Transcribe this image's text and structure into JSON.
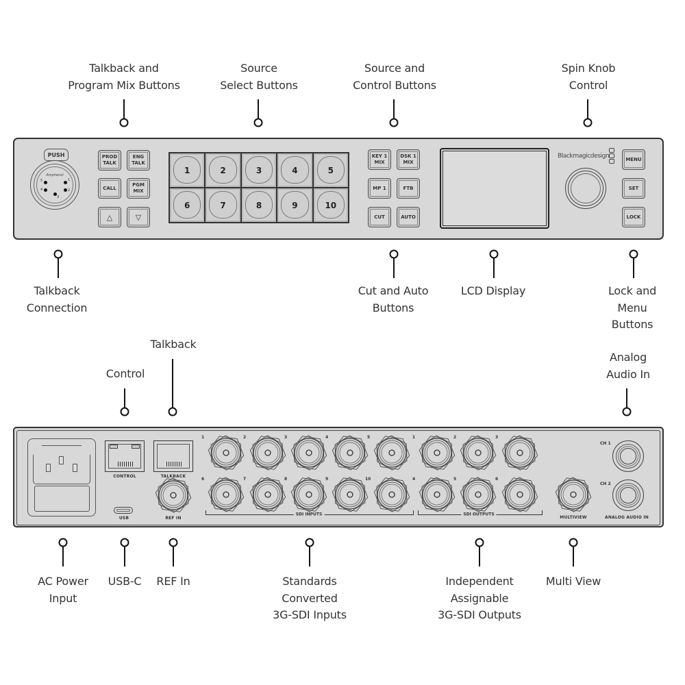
{
  "front_panel": {
    "callouts_top": [
      {
        "id": "talkback-program-mix",
        "text": "Talkback and\nProgram Mix Buttons"
      },
      {
        "id": "source-select",
        "text": "Source\nSelect Buttons"
      },
      {
        "id": "source-control",
        "text": "Source and\nControl  Buttons"
      },
      {
        "id": "spin-knob",
        "text": "Spin Knob\nControl"
      }
    ],
    "callouts_bottom": [
      {
        "id": "talkback-connection",
        "text": "Talkback\nConnection"
      },
      {
        "id": "cut-auto",
        "text": "Cut and Auto\nButtons"
      },
      {
        "id": "lcd-display",
        "text": "LCD Display"
      },
      {
        "id": "lock-menu",
        "text": "Lock and\nMenu Buttons"
      }
    ],
    "xlr": {
      "tab_label": "PUSH",
      "brand": "Amphenol",
      "pins": [
        "1",
        "2",
        "3",
        "4",
        "5"
      ]
    },
    "talkback_buttons": [
      {
        "label": "PROD\nTALK"
      },
      {
        "label": "ENG\nTALK"
      },
      {
        "label": "CALL"
      },
      {
        "label": "PGM\nMIX"
      },
      {
        "label": "△",
        "icon": "triangle-up-icon"
      },
      {
        "label": "▽",
        "icon": "triangle-down-icon"
      }
    ],
    "source_buttons": [
      "1",
      "2",
      "3",
      "4",
      "5",
      "6",
      "7",
      "8",
      "9",
      "10"
    ],
    "control_buttons": [
      {
        "label": "KEY 1\nMIX"
      },
      {
        "label": "DSK 1\nMIX"
      },
      {
        "label": "MP 1"
      },
      {
        "label": "FTB"
      },
      {
        "label": "CUT"
      },
      {
        "label": "AUTO"
      }
    ],
    "brand": "Blackmagicdesign",
    "menu_buttons": [
      {
        "label": "MENU"
      },
      {
        "label": "SET"
      },
      {
        "label": "LOCK"
      }
    ]
  },
  "rear_panel": {
    "callouts_top": [
      {
        "id": "control",
        "text": "Control"
      },
      {
        "id": "talkback",
        "text": "Talkback"
      },
      {
        "id": "analog-audio-in",
        "text": "Analog\nAudio In"
      }
    ],
    "callouts_bottom": [
      {
        "id": "ac-power",
        "text": "AC Power\nInput"
      },
      {
        "id": "usb-c",
        "text": "USB-C"
      },
      {
        "id": "ref-in",
        "text": "REF In"
      },
      {
        "id": "sdi-inputs",
        "text": "Standards\nConverted\n3G-SDI Inputs"
      },
      {
        "id": "sdi-outputs",
        "text": "Independent\nAssignable\n3G-SDI Outputs"
      },
      {
        "id": "multiview",
        "text": "Multi View"
      }
    ],
    "port_labels": {
      "control": "CONTROL",
      "talkback": "TALKBACK",
      "usb": "USB",
      "ref_in": "REF IN",
      "sdi_inputs": "SDI INPUTS",
      "sdi_outputs": "SDI OUTPUTS",
      "multiview": "MULTIVIEW",
      "analog_audio_in": "ANALOG AUDIO IN",
      "ch1": "CH 1",
      "ch2": "CH 2"
    },
    "sdi_input_numbers": [
      "1",
      "2",
      "3",
      "4",
      "5",
      "6",
      "7",
      "8",
      "9",
      "10"
    ],
    "sdi_output_numbers": [
      "1",
      "2",
      "3",
      "4",
      "5",
      "6"
    ]
  }
}
